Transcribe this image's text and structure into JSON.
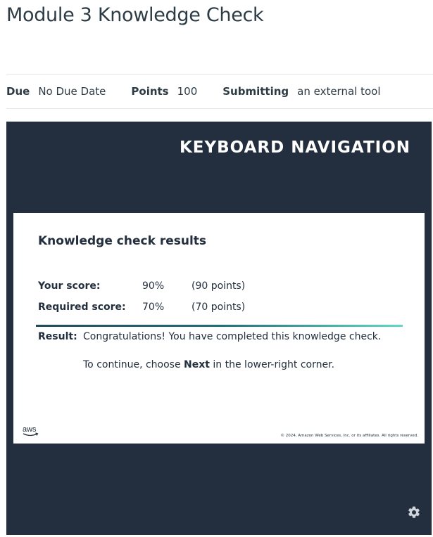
{
  "page": {
    "title": "Module 3 Knowledge Check"
  },
  "details": {
    "due_label": "Due",
    "due_value": "No Due Date",
    "points_label": "Points",
    "points_value": "100",
    "submitting_label": "Submitting",
    "submitting_value": "an external tool"
  },
  "tool": {
    "header": "KEYBOARD NAVIGATION",
    "card_title": "Knowledge check results",
    "your_score_label": "Your score:",
    "your_score_pct": "90%",
    "your_score_points": "(90 points)",
    "required_score_label": "Required score:",
    "required_score_pct": "70%",
    "required_score_points": "(70 points)",
    "result_label": "Result:",
    "result_text": "Congratulations! You have completed this knowledge check.",
    "continue_prefix": "To continue, choose ",
    "continue_bold": "Next",
    "continue_suffix": " in the lower-right corner.",
    "logo_text": "aws",
    "copyright": "© 2024, Amazon Web Services, Inc. or its affiliates. All rights reserved."
  },
  "icons": {
    "logo": "aws-logo-icon",
    "settings": "gear-icon"
  },
  "colors": {
    "frame_bg": "#232f3e",
    "accent_gradient_start": "#1f4b5c",
    "accent_gradient_end": "#5fdac8",
    "aws_orange": "#ff9900"
  }
}
